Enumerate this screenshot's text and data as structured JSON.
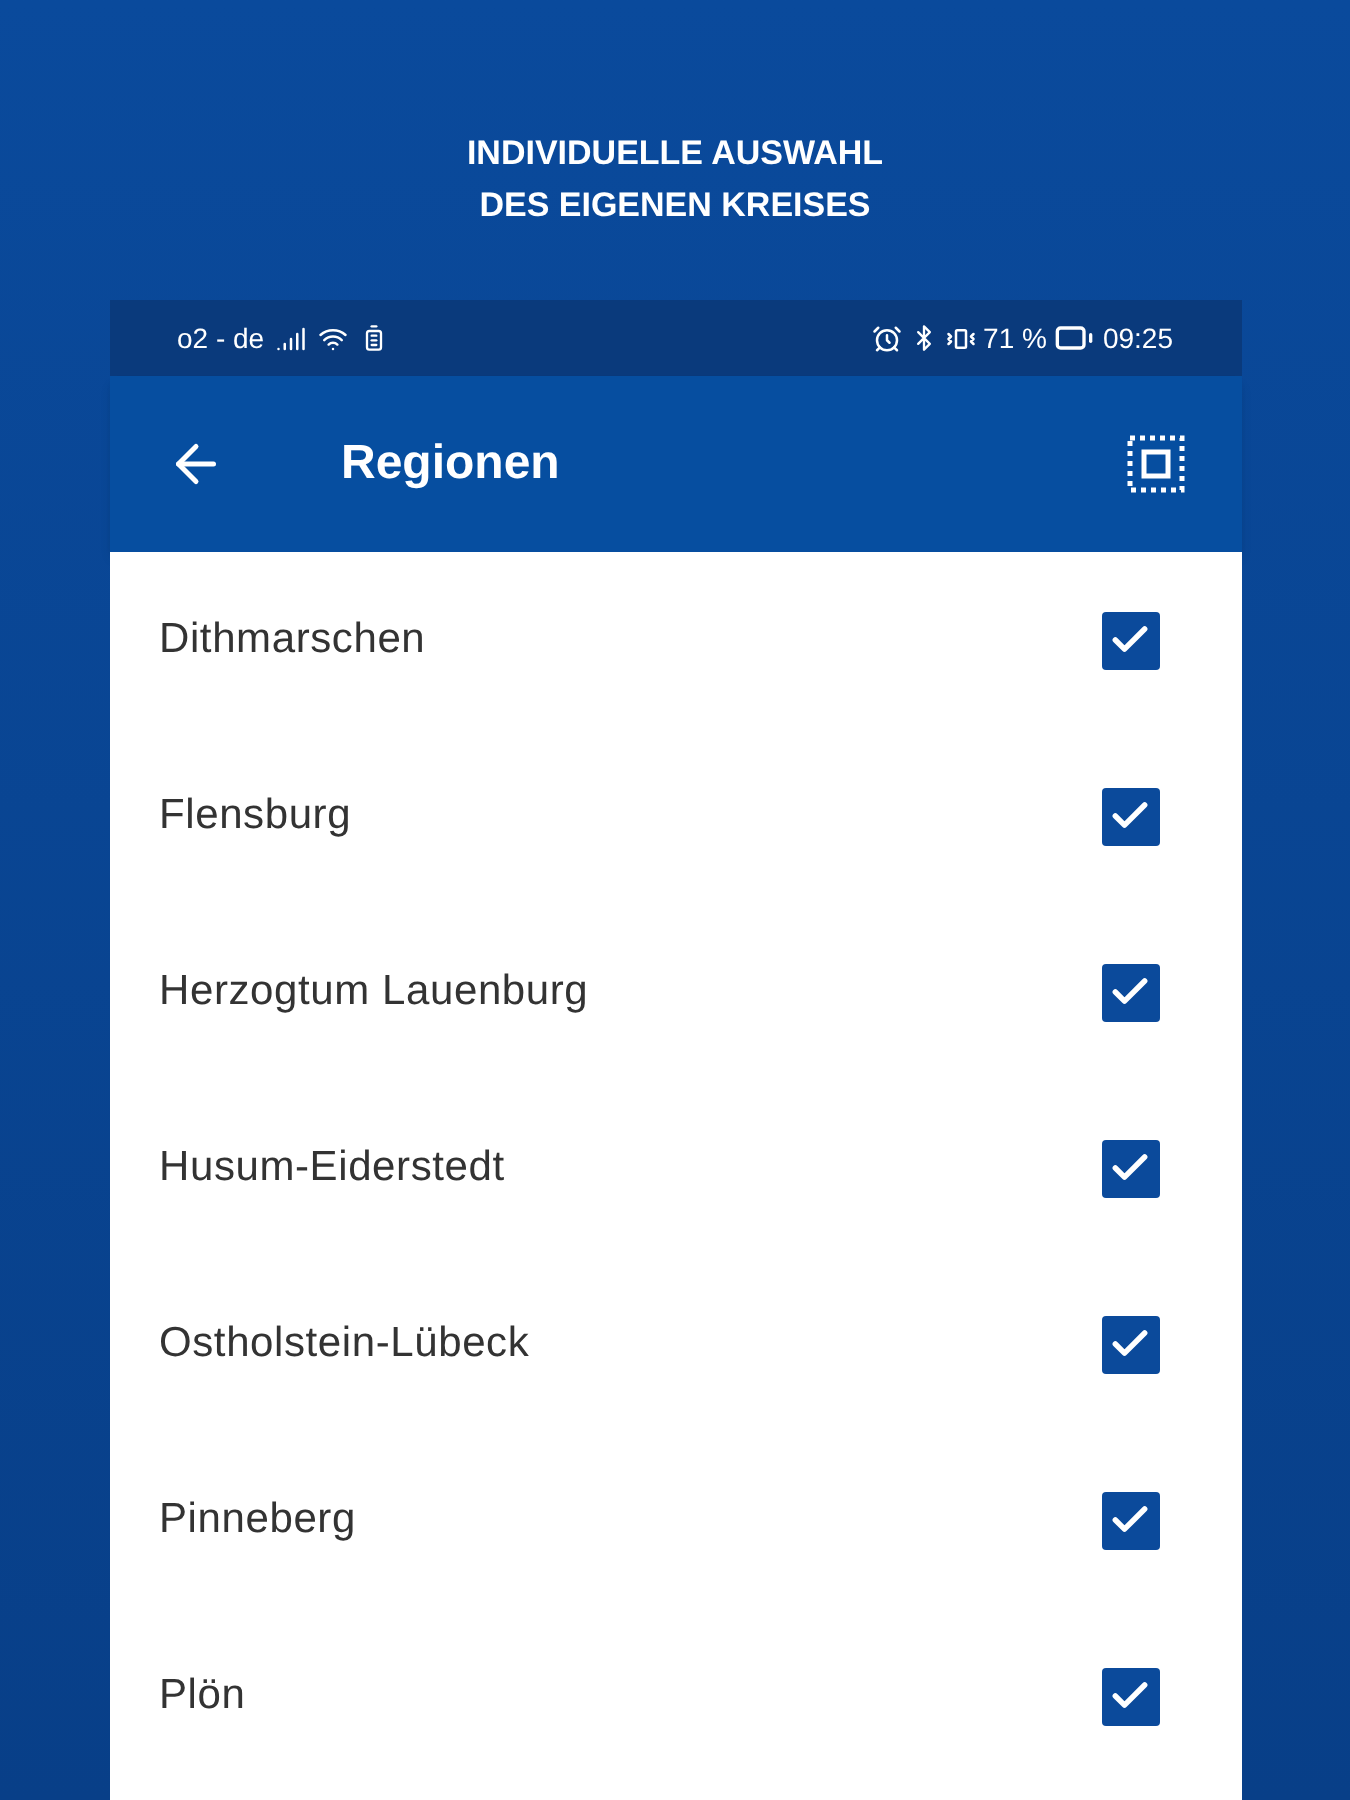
{
  "headline": [
    "INDIVIDUELLE AUSWAHL",
    "DES EIGENEN KREISES"
  ],
  "status_bar": {
    "carrier": "o2 - de",
    "battery": "71 %",
    "time": "09:25"
  },
  "app_bar": {
    "title": "Regionen"
  },
  "regions": [
    {
      "label": "Dithmarschen",
      "checked": true
    },
    {
      "label": "Flensburg",
      "checked": true
    },
    {
      "label": "Herzogtum Lauenburg",
      "checked": true
    },
    {
      "label": "Husum-Eiderstedt",
      "checked": true
    },
    {
      "label": "Ostholstein-Lübeck",
      "checked": true
    },
    {
      "label": "Pinneberg",
      "checked": true
    },
    {
      "label": "Plön",
      "checked": true
    }
  ]
}
